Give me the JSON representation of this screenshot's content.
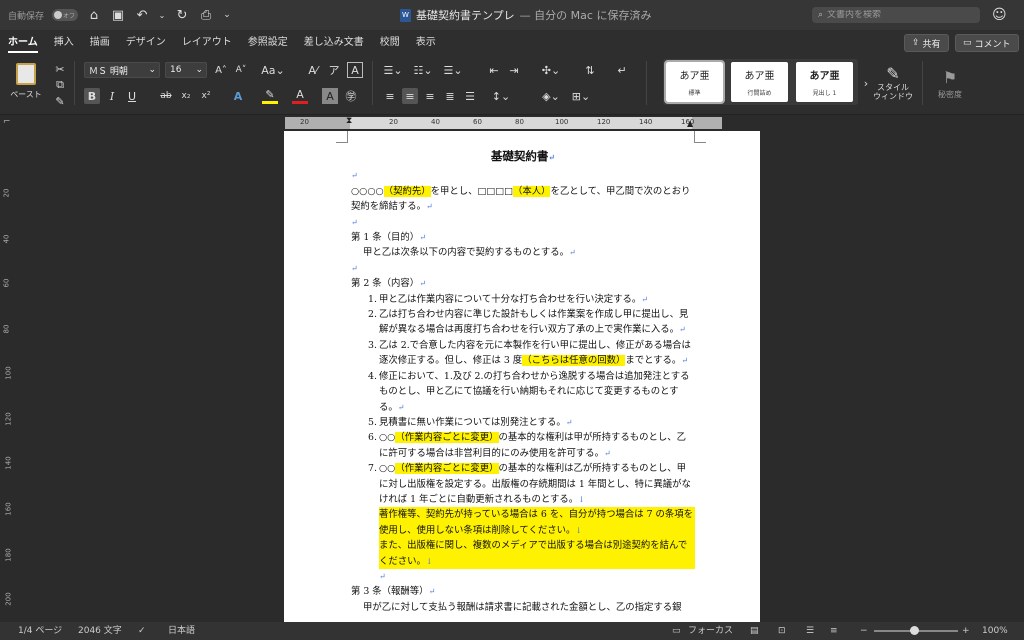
{
  "titlebar": {
    "autosave_label": "自動保存",
    "autosave_state": "オフ",
    "doc_name": "基礎契約書テンプレ",
    "doc_location": "— 自分の Mac に保存済み",
    "search_placeholder": "文書内を検索"
  },
  "tabs": [
    "ホーム",
    "挿入",
    "描画",
    "デザイン",
    "レイアウト",
    "参照設定",
    "差し込み文書",
    "校閲",
    "表示"
  ],
  "actions": {
    "share": "共有",
    "comment": "コメント"
  },
  "ribbon": {
    "paste_label": "ペースト",
    "font_name": "ＭＳ 明朝",
    "font_size": "16",
    "styles": [
      {
        "sample": "あア亜",
        "name": "標準"
      },
      {
        "sample": "あア亜",
        "name": "行間詰め"
      },
      {
        "sample": "あア亜",
        "name": "見出し 1"
      }
    ],
    "style_window_label": "スタイル\nウィンドウ",
    "sensitivity_label": "秘密度"
  },
  "ruler": {
    "h_ticks": [
      "20",
      "20",
      "40",
      "60",
      "80",
      "100",
      "120",
      "140",
      "160"
    ],
    "v_ticks": [
      "20",
      "40",
      "60",
      "80",
      "100",
      "120",
      "140",
      "160",
      "180",
      "200"
    ]
  },
  "document": {
    "title": "基礎契約書",
    "intro_1": "○○○○",
    "intro_hl_1": "（契約先）",
    "intro_2": "を甲とし、□□□□",
    "intro_hl_2": "（本人）",
    "intro_3": "を乙として、甲乙間で次のとおり契約を締結する。",
    "art1_heading": "第 1 条（目的）",
    "art1_body": "甲と乙は次条以下の内容で契約するものとする。",
    "art2_heading": "第 2 条（内容）",
    "item1": "甲と乙は作業内容について十分な打ち合わせを行い決定する。",
    "item2": "乙は打ち合わせ内容に準じた設計もしくは作業案を作成し甲に提出し、見解が異なる場合は再度打ち合わせを行い双方了承の上で実作業に入る。",
    "item3_a": "乙は 2.で合意した内容を元に本製作を行い甲に提出し、修正がある場合は逐次修正する。但し、修正は 3 度",
    "item3_hl": "（こちらは任意の回数）",
    "item3_b": "までとする。",
    "item4": "修正において、1.及び 2.の打ち合わせから逸脱する場合は追加発注とするものとし、甲と乙にて協議を行い納期もそれに応じて変更するものとする。",
    "item5": "見積書に無い作業については別発注とする。",
    "item6_a": "○○",
    "item6_hl": "（作業内容ごとに変更）",
    "item6_b": "の基本的な権利は甲が所持するものとし、乙に許可する場合は非営利目的にのみ使用を許可する。",
    "item7_a": "○○",
    "item7_hl": "（作業内容ごとに変更）",
    "item7_b": "の基本的な権利は乙が所持するものとし、甲に対し出版権を設定する。出版権の存続期間は 1 年間とし、特に異議がなければ 1 年ごとに自動更新されるものとする。",
    "note_1": "著作権等、契約先が持っている場合は 6 を、自分が持つ場合は 7 の条項を使用し、使用しない条項は削除してください。",
    "note_2": "また、出版権に関し、複数のメディアで出版する場合は別途契約を結んでください。",
    "art3_heading": "第 3 条（報酬等）",
    "art3_body": "甲が乙に対して支払う報酬は請求書に記載された金額とし、乙の指定する銀"
  },
  "status": {
    "page": "1/4 ページ",
    "words": "2046 文字",
    "language": "日本語",
    "focus": "フォーカス",
    "zoom": "100%"
  }
}
